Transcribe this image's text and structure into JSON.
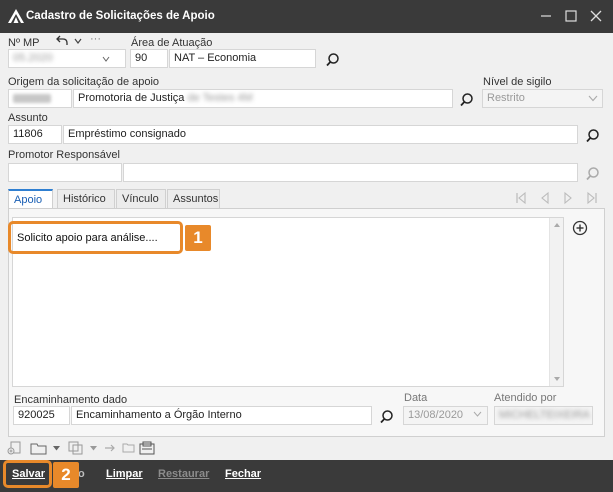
{
  "window": {
    "title": "Cadastro de Solicitações de Apoio"
  },
  "labels": {
    "nr_mp": "Nº MP",
    "area": "Área de Atuação",
    "origem": "Origem da solicitação de apoio",
    "sigilo": "Nível de sigilo",
    "assunto": "Assunto",
    "promotor": "Promotor Responsável",
    "encaminhamento": "Encaminhamento dado",
    "data": "Data",
    "atendido": "Atendido por"
  },
  "fields": {
    "nr_mp_value": "05.2020",
    "area_code": "90",
    "area_desc": "NAT – Economia",
    "origem_desc": "Promotoria de Justiça",
    "origem_desc_suffix": "de Testes 4M",
    "sigilo_value": "Restrito",
    "assunto_code": "11806",
    "assunto_desc": "Empréstimo consignado",
    "encaminhamento_code": "920025",
    "encaminhamento_desc": "Encaminhamento a Órgão Interno",
    "data_value": "13/08/2020",
    "atendido_value": "MICHELTEIXEIRA"
  },
  "tabs": [
    "Apoio",
    "Histórico",
    "Vínculo",
    "Assuntos"
  ],
  "apoio_text": "Solicito apoio para análise....",
  "callouts": {
    "one": "1",
    "two": "2"
  },
  "buttons": {
    "salvar": "Salvar",
    "hidden_fragment": "o",
    "limpar": "Limpar",
    "restaurar": "Restaurar",
    "fechar": "Fechar"
  },
  "colors": {
    "accent": "#e8892a",
    "titlebar": "#3a3a3a",
    "tab_active": "#1a5fb4"
  }
}
